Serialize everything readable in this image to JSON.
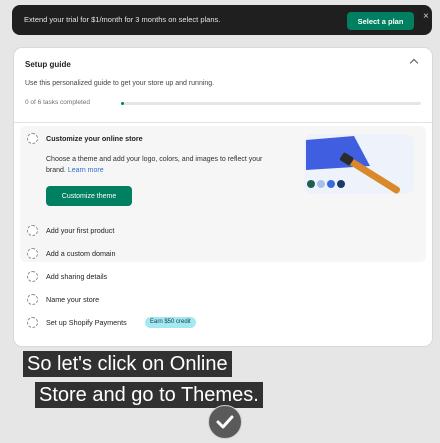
{
  "banner": {
    "text": "Extend your trial for $1/month for 3 months on select plans.",
    "button_label": "Select a plan",
    "close_glyph": "×"
  },
  "setup_guide": {
    "title": "Setup guide",
    "description": "Use this personalized guide to get your store up and running.",
    "tasks_progress": "0 of 6 tasks completed",
    "progress_fraction": 0.0,
    "active_task": {
      "title": "Customize your online store",
      "body": "Choose a theme and add your logo, colors, and images to reflect your brand.",
      "learn_more": "Learn more",
      "button_label": "Customize theme"
    },
    "tasks": [
      {
        "label": "Add your first product"
      },
      {
        "label": "Add a custom domain"
      },
      {
        "label": "Add sharing details"
      },
      {
        "label": "Name your store"
      },
      {
        "label": "Set up Shopify Payments",
        "badge": "Earn $50 credit"
      }
    ]
  },
  "caption": {
    "line1": "So let's click on Online",
    "line2": "Store and go to Themes."
  },
  "colors": {
    "accent": "#008060",
    "banner_bg": "#1f1f1f",
    "badge_bg": "#a4e8f2",
    "link": "#2c6ecb"
  },
  "icons": {
    "banner_close": "close-icon",
    "collapse": "chevron-up-icon",
    "task_status": "dashed-circle-icon",
    "illustration": "paintbrush-illustration",
    "overlay": "checkmark-icon"
  }
}
